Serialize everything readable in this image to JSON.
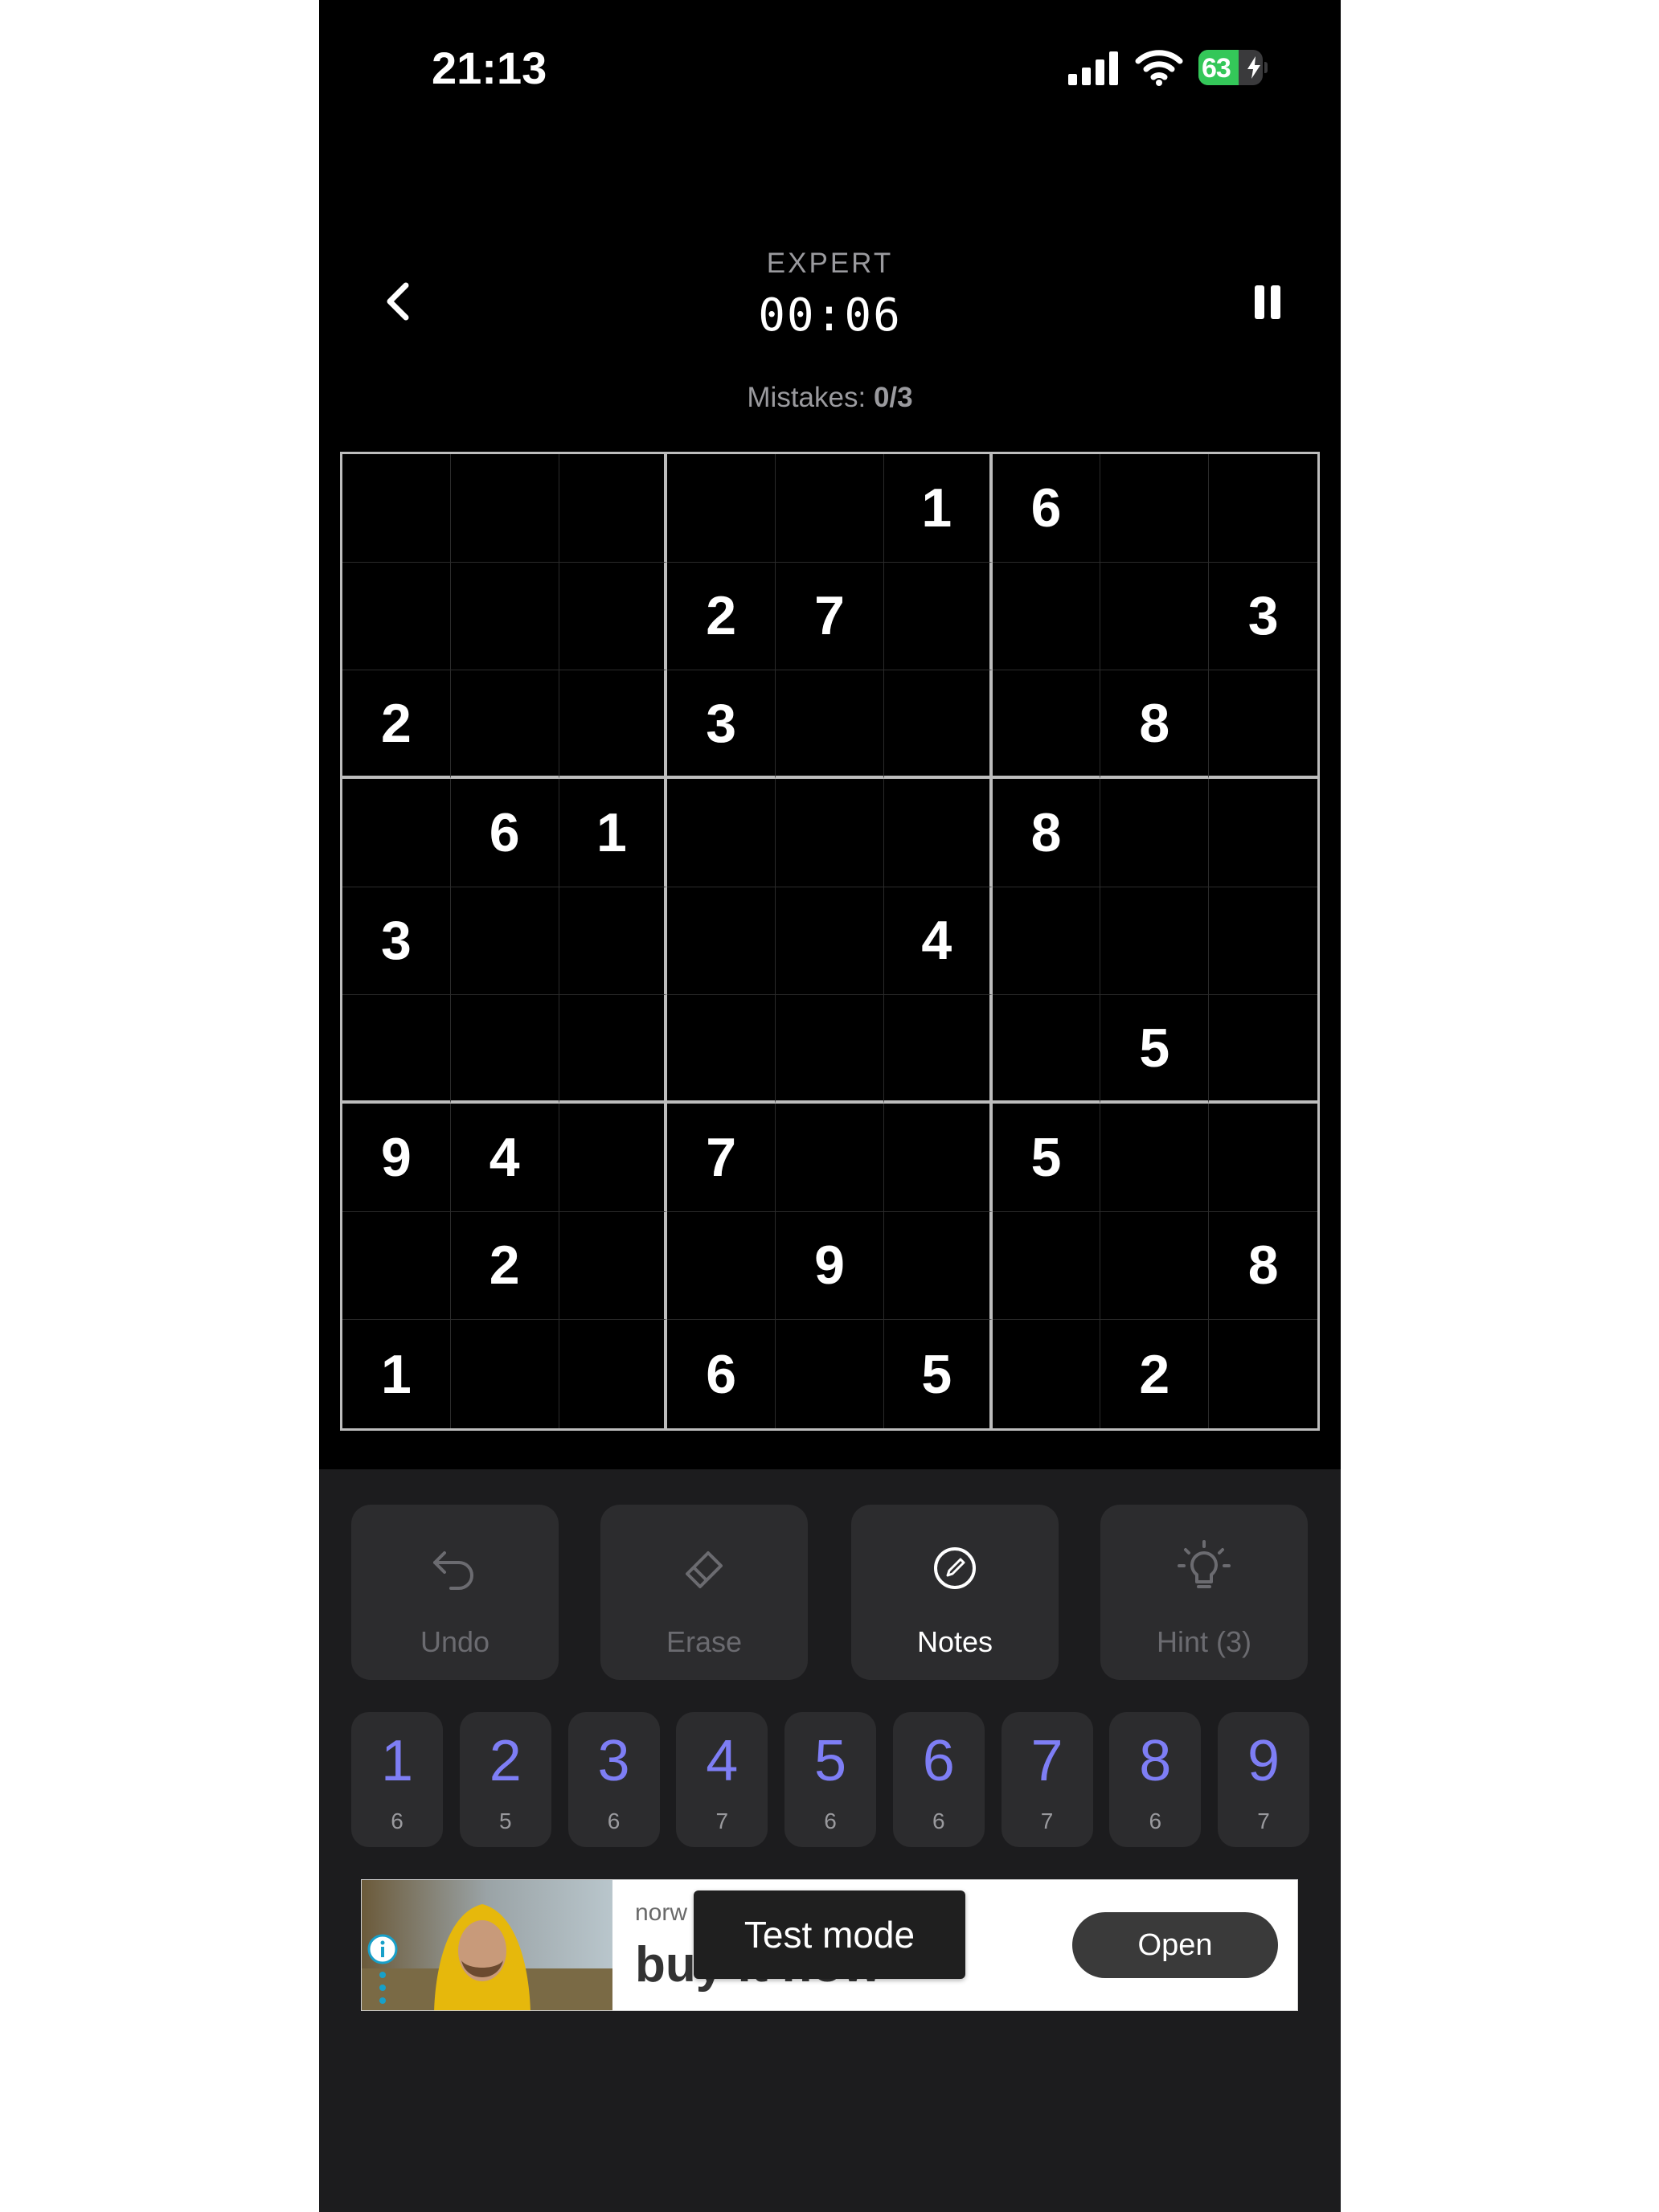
{
  "status_bar": {
    "time": "21:13",
    "battery_level": "63",
    "battery_fraction": 0.63,
    "battery_charging": true,
    "icons": [
      "cellular-signal-icon",
      "wifi-icon",
      "battery-icon"
    ]
  },
  "header": {
    "difficulty": "EXPERT",
    "timer": "00:06",
    "mistakes_label": "Mistakes:",
    "mistakes_value": "0/3"
  },
  "board": [
    [
      null,
      null,
      null,
      null,
      null,
      "1",
      "6",
      null,
      null
    ],
    [
      null,
      null,
      null,
      "2",
      "7",
      null,
      null,
      null,
      "3"
    ],
    [
      "2",
      null,
      null,
      "3",
      null,
      null,
      null,
      "8",
      null
    ],
    [
      null,
      "6",
      "1",
      null,
      null,
      null,
      "8",
      null,
      null
    ],
    [
      "3",
      null,
      null,
      null,
      null,
      "4",
      null,
      null,
      null
    ],
    [
      null,
      null,
      null,
      null,
      null,
      null,
      null,
      "5",
      null
    ],
    [
      "9",
      "4",
      null,
      "7",
      null,
      null,
      "5",
      null,
      null
    ],
    [
      null,
      "2",
      null,
      null,
      "9",
      null,
      null,
      null,
      "8"
    ],
    [
      "1",
      null,
      null,
      "6",
      null,
      "5",
      null,
      "2",
      null
    ]
  ],
  "tools": [
    {
      "label": "Undo",
      "icon": "undo-icon",
      "active": false
    },
    {
      "label": "Erase",
      "icon": "eraser-icon",
      "active": false
    },
    {
      "label": "Notes",
      "icon": "pencil-circle-icon",
      "active": true
    },
    {
      "label": "Hint (3)",
      "icon": "lightbulb-icon",
      "active": false
    }
  ],
  "numpad": [
    {
      "digit": "1",
      "remaining": "6"
    },
    {
      "digit": "2",
      "remaining": "5"
    },
    {
      "digit": "3",
      "remaining": "6"
    },
    {
      "digit": "4",
      "remaining": "7"
    },
    {
      "digit": "5",
      "remaining": "6"
    },
    {
      "digit": "6",
      "remaining": "6"
    },
    {
      "digit": "7",
      "remaining": "7"
    },
    {
      "digit": "8",
      "remaining": "6"
    },
    {
      "digit": "9",
      "remaining": "7"
    }
  ],
  "ad": {
    "brand": "norw",
    "headline": "buy it now",
    "button_label": "Open",
    "overlay": "Test mode"
  },
  "colors": {
    "background": "#000000",
    "panel": "#2c2c2e",
    "accent_digit": "#7e7ef5",
    "grid_line": "#bdbdbd",
    "battery_green": "#34c759"
  }
}
